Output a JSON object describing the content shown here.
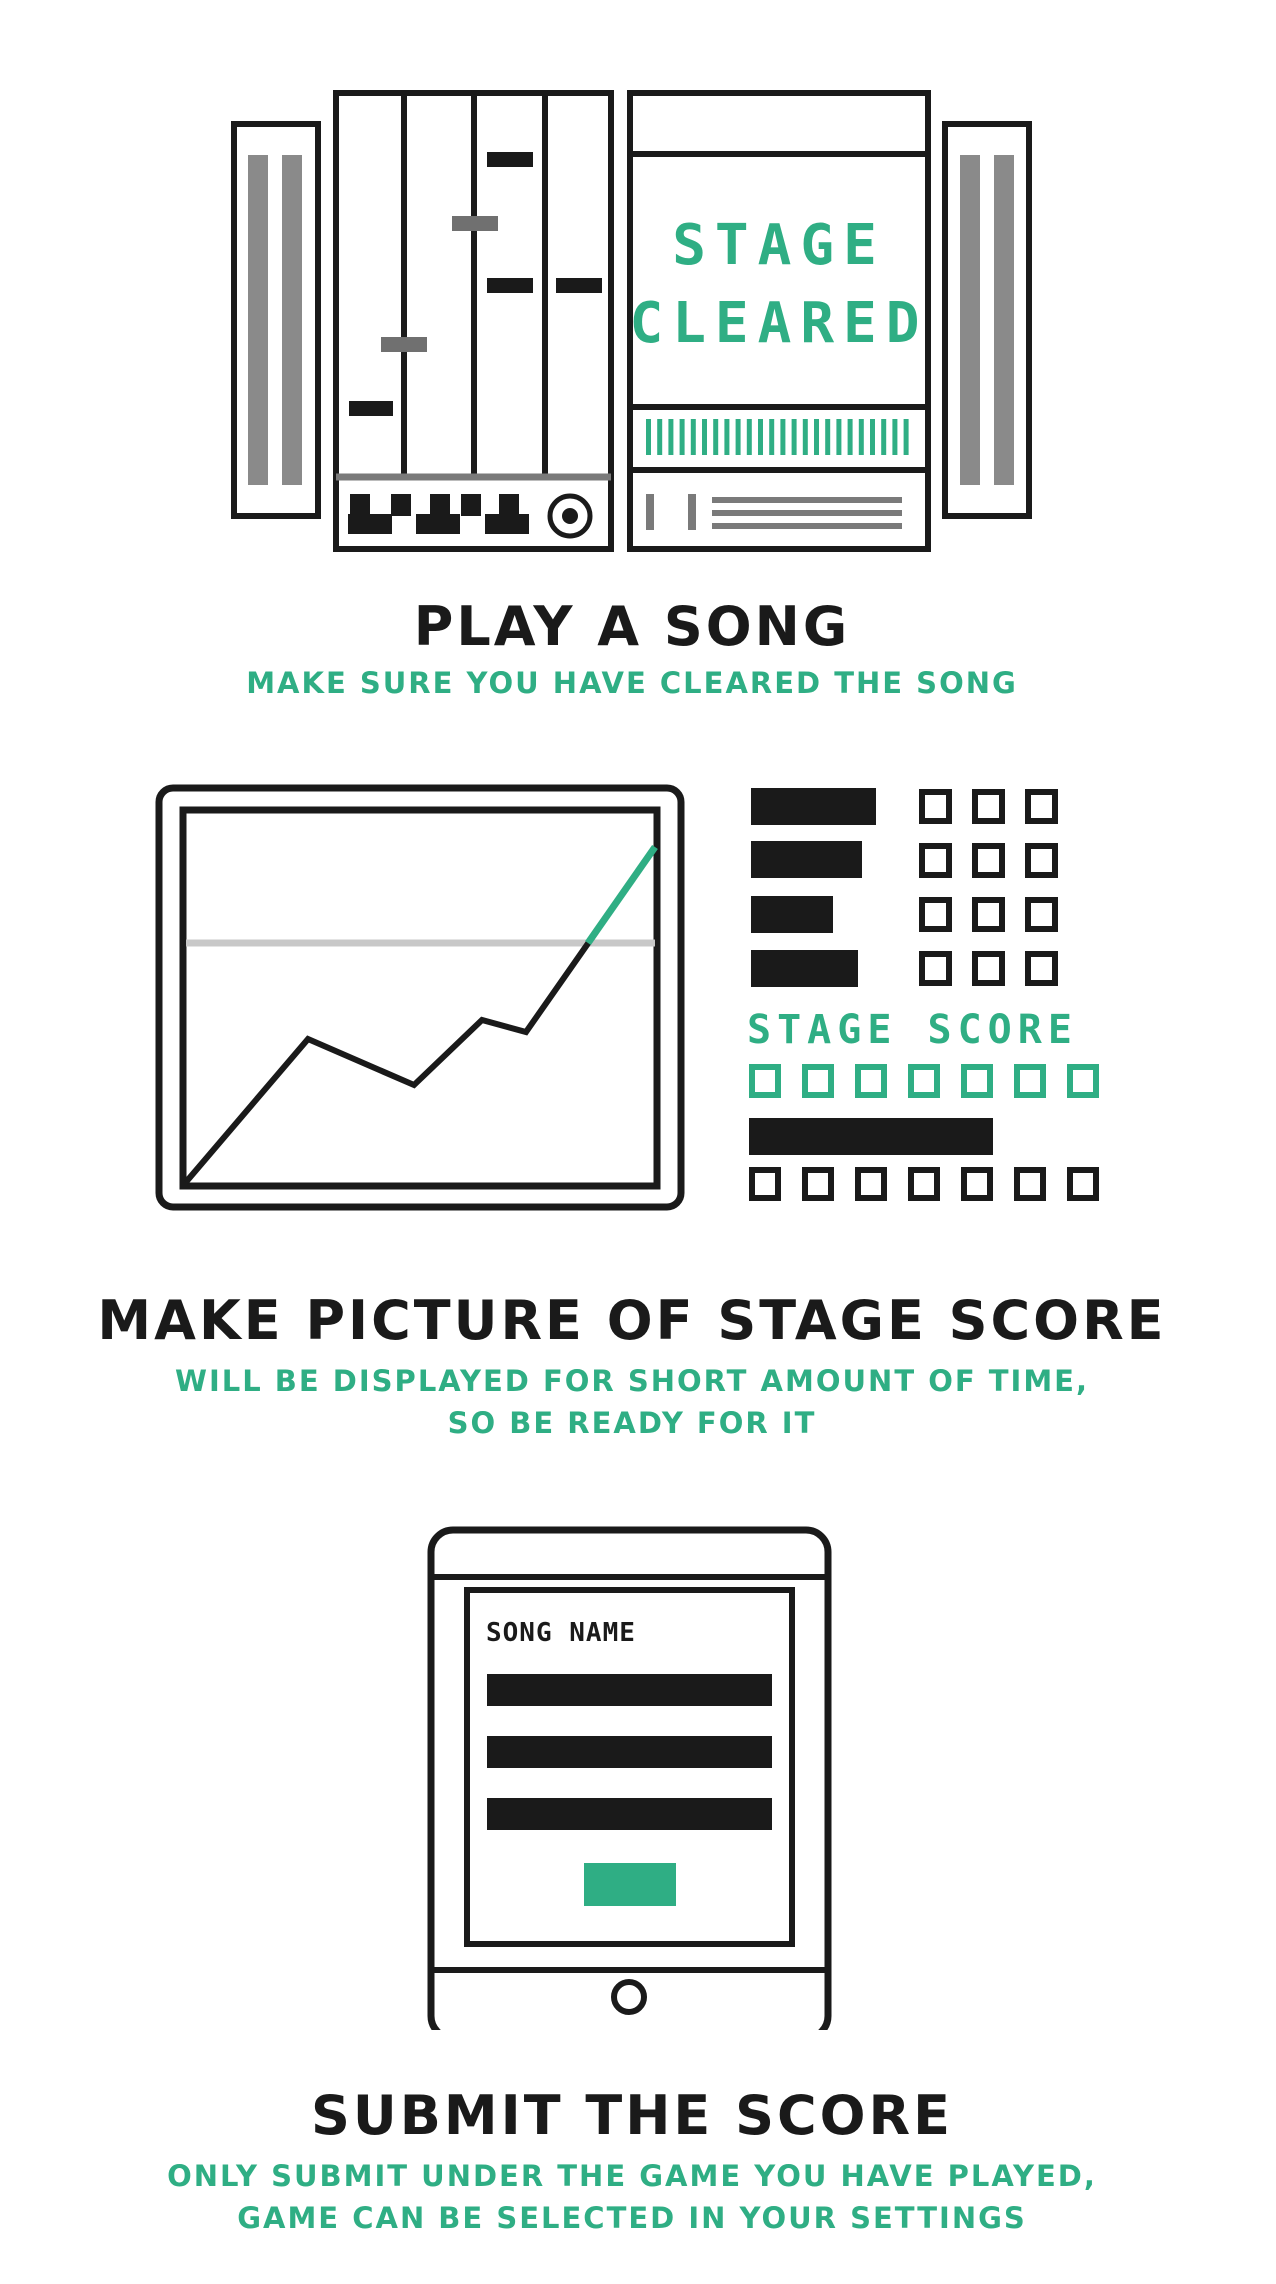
{
  "colors": {
    "ink": "#1a1a1a",
    "accent": "#2fae84",
    "gray": "#7a7a7a",
    "light_gray": "#c8c8c8",
    "background": "#ffffff"
  },
  "steps": [
    {
      "title": "PLAY A SONG",
      "subtitle_lines": [
        "MAKE SURE YOU HAVE CLEARED THE SONG"
      ],
      "illustration": {
        "icon": "arcade-cabinet-icon",
        "screen_text_line1": "STAGE",
        "screen_text_line2": "CLEARED"
      }
    },
    {
      "title": "MAKE PICTURE OF STAGE SCORE",
      "subtitle_lines": [
        "WILL BE DISPLAYED FOR SHORT AMOUNT OF TIME,",
        "SO BE READY FOR IT"
      ],
      "illustration": {
        "icon": "score-screen-icon",
        "score_label": "STAGE SCORE"
      }
    },
    {
      "title": "SUBMIT THE SCORE",
      "subtitle_lines": [
        "ONLY SUBMIT UNDER THE GAME YOU HAVE PLAYED,",
        "GAME CAN BE SELECTED IN YOUR SETTINGS"
      ],
      "illustration": {
        "icon": "tablet-form-icon",
        "form_label": "SONG NAME"
      }
    }
  ]
}
